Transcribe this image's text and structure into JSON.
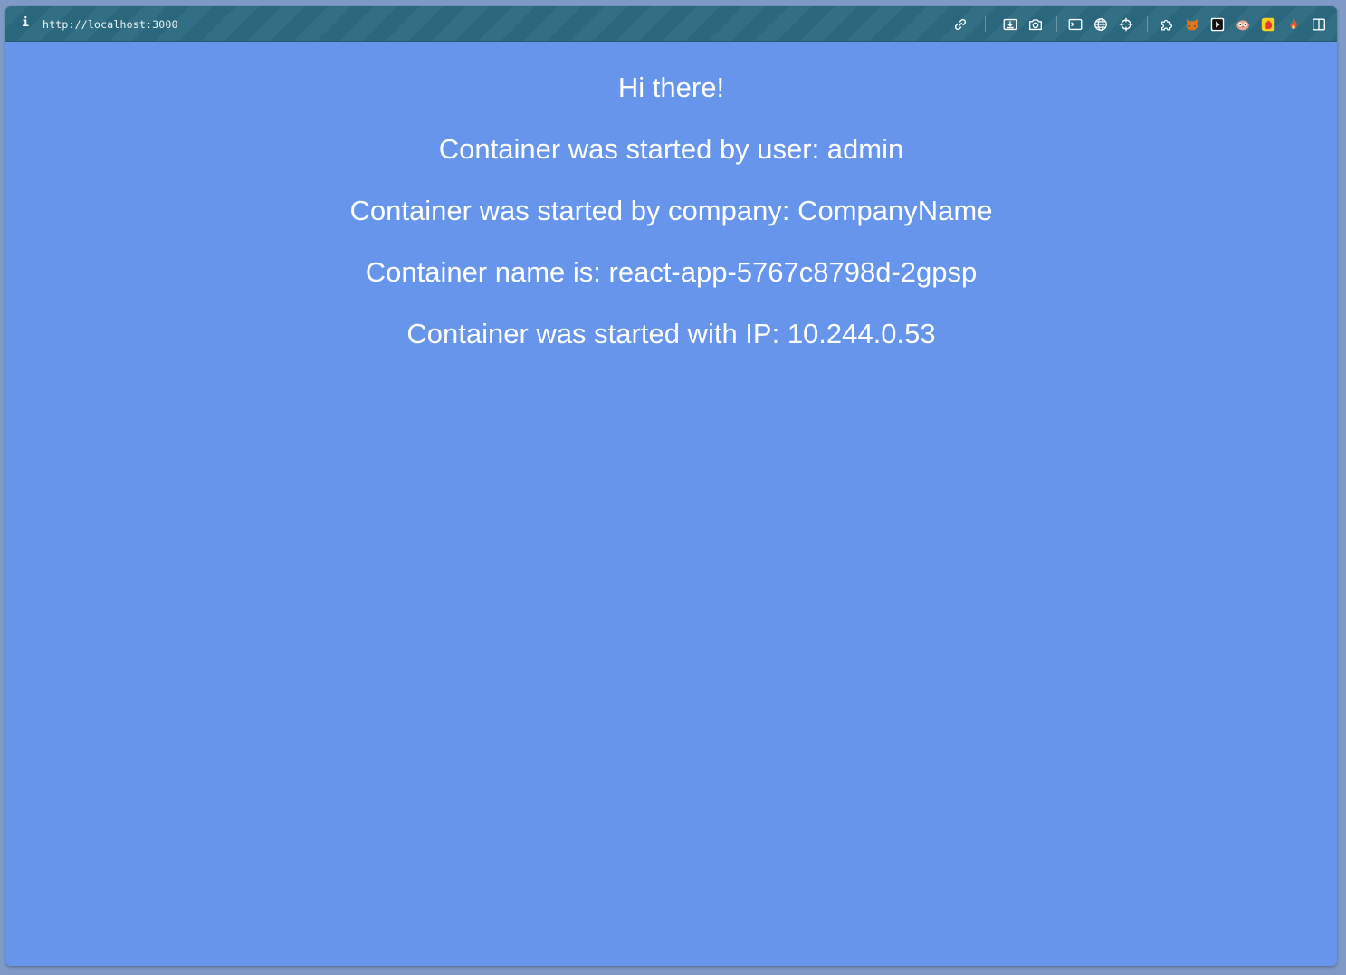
{
  "browser": {
    "url": "http://localhost:3000",
    "info_icon": "info-icon",
    "toolbar_icons": [
      "link-icon",
      "save-page-icon",
      "camera-icon",
      "terminal-icon",
      "globe-icon",
      "crosshair-icon",
      "puzzle-icon",
      "fox-extension-icon",
      "dark-extension-icon",
      "owl-extension-icon",
      "hand-extension-icon",
      "flame-extension-icon",
      "sidebar-icon"
    ]
  },
  "page": {
    "background_color": "#6695eb",
    "greeting": "Hi there!",
    "user_line": "Container was started by user: admin",
    "company_line": "Container was started by company: CompanyName",
    "name_line": "Container name is: react-app-5767c8798d-2gpsp",
    "ip_line": "Container was started with IP: 10.244.0.53"
  }
}
